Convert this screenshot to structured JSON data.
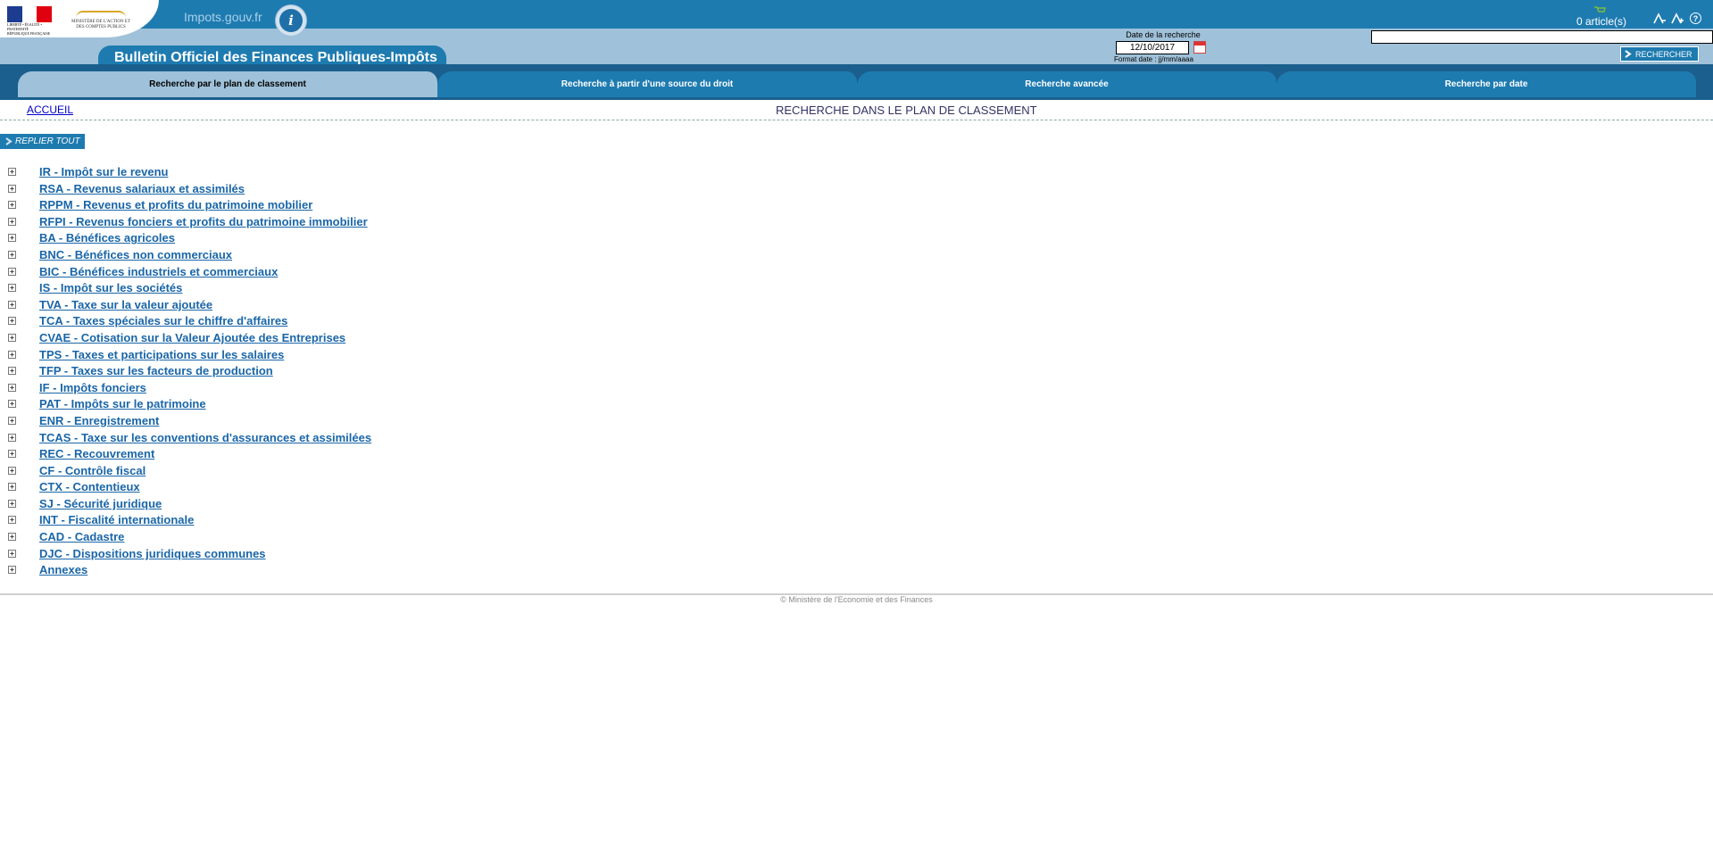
{
  "header": {
    "site_name": "Impots.gouv.fr",
    "republic_motto": "Liberté • Égalité • Fraternité",
    "republic_name": "République Française",
    "ministry": "Ministère de l'action et des comptes publics",
    "title": "Bulletin Officiel des Finances Publiques-Impôts",
    "cart_count": "0 article(s)",
    "help_symbol": "?",
    "brand_color": "#1e7bb0",
    "band_color": "#9fc1d9"
  },
  "search": {
    "date_label": "Date de la recherche",
    "date_value": "12/10/2017",
    "date_format": "Format date : jj/mm/aaaa",
    "query_value": "",
    "button_label": "RECHERCHER"
  },
  "tabs": [
    {
      "label": "Recherche par le plan de classement",
      "active": true
    },
    {
      "label": "Recherche à partir d'une source du droit",
      "active": false
    },
    {
      "label": "Recherche avancée",
      "active": false
    },
    {
      "label": "Recherche par date",
      "active": false
    }
  ],
  "breadcrumb": {
    "home": "ACCUEIL"
  },
  "page_title": "RECHERCHE DANS LE PLAN DE CLASSEMENT",
  "collapse_all_label": "REPLIER TOUT",
  "tree": [
    "IR - Impôt sur le revenu",
    "RSA - Revenus salariaux et assimilés",
    "RPPM - Revenus et profits du patrimoine mobilier",
    "RFPI - Revenus fonciers et profits du patrimoine immobilier",
    "BA - Bénéfices agricoles",
    "BNC - Bénéfices non commerciaux",
    "BIC - Bénéfices industriels et commerciaux",
    "IS - Impôt sur les sociétés",
    "TVA - Taxe sur la valeur ajoutée",
    "TCA - Taxes spéciales sur le chiffre d'affaires",
    "CVAE - Cotisation sur la Valeur Ajoutée des Entreprises",
    "TPS - Taxes et participations sur les salaires",
    "TFP - Taxes sur les facteurs de production",
    "IF - Impôts fonciers",
    "PAT - Impôts sur le patrimoine",
    "ENR - Enregistrement",
    "TCAS - Taxe sur les conventions d'assurances et assimilées",
    "REC - Recouvrement",
    "CF - Contrôle fiscal",
    "CTX - Contentieux",
    "SJ - Sécurité juridique",
    "INT - Fiscalité internationale",
    "CAD - Cadastre",
    "DJC - Dispositions juridiques communes",
    "Annexes"
  ],
  "footer": "© Ministère de l'Economie et des Finances"
}
